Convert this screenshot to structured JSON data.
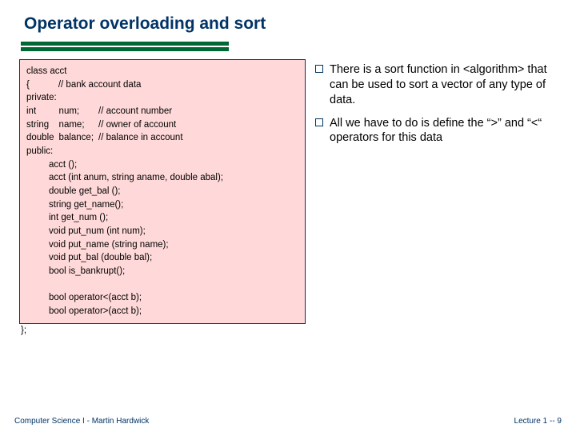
{
  "title": "Operator overloading and sort",
  "code": {
    "l01": "class acct",
    "l02a": "{",
    "l02b": "// bank account data",
    "l03": "private:",
    "l04a": "int",
    "l04b": "num;",
    "l04c": "// account number",
    "l05a": "string",
    "l05b": "name;",
    "l05c": "// owner of account",
    "l06a": "double",
    "l06b": "balance;",
    "l06c": "// balance in account",
    "l07": "public:",
    "l08": "acct ();",
    "l09": "acct (int anum, string aname, double abal);",
    "l10": "double get_bal ();",
    "l11": "string get_name();",
    "l12": "int get_num ();",
    "l13": "void put_num (int num);",
    "l14": "void put_name (string name);",
    "l15": "void put_bal (double bal);",
    "l16": "bool is_bankrupt();",
    "l17": "",
    "l18": "bool operator<(acct b);",
    "l19": "bool operator>(acct b);"
  },
  "close": "};",
  "bullets": [
    "There is a sort function in <algorithm> that can be used to sort a vector of any type of data.",
    "All we have to do is define the “>” and “<“ operators for this data"
  ],
  "footer": {
    "left": "Computer Science I - Martin Hardwick",
    "right": "Lecture 1   --   9"
  }
}
